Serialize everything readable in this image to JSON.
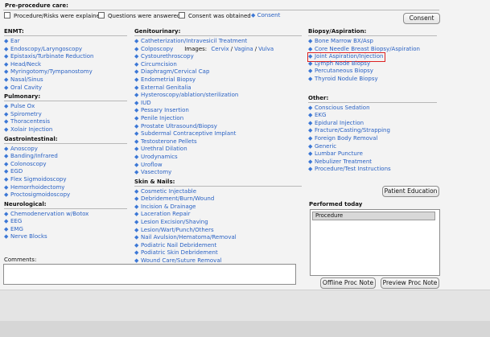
{
  "preprocedure": {
    "title": "Pre-procedure care:",
    "checks": [
      "Procedure/Risks were explained",
      "Questions were answered",
      "Consent was obtained"
    ],
    "consent_link": "Consent",
    "consent_button": "Consent"
  },
  "col1": [
    {
      "title": "ENMT:",
      "items": [
        "Ear",
        "Endoscopy/Laryngoscopy",
        "Epistaxis/Turbinate Reduction",
        "Head/Neck",
        "Myringotomy/Tympanostomy",
        "Nasal/Sinus",
        "Oral Cavity"
      ]
    },
    {
      "title": "Pulmonary:",
      "items": [
        "Pulse Ox",
        "Spirometry",
        "Thoracentesis",
        "Xolair Injection"
      ]
    },
    {
      "title": "Gastrointestinal:",
      "items": [
        "Anoscopy",
        "Banding/Infrared",
        "Colonoscopy",
        "EGD",
        "Flex Sigmoidoscopy",
        "Hemorrhoidectomy",
        "Proctosigmoidoscopy"
      ]
    },
    {
      "title": "Neurological:",
      "items": [
        "Chemodenervation w/Botox",
        "EEG",
        "EMG",
        "Nerve Blocks"
      ]
    }
  ],
  "col2": [
    {
      "title": "Genitourinary:",
      "items": [
        "Catheterization/Intravesicil Treatment",
        "Colposcopy",
        "Cystourethroscopy",
        "Circumcision",
        "Diaphragm/Cervical Cap",
        "Endometrial Biopsy",
        "External Genitalia",
        "Hysteroscopy/ablation/sterilization",
        "IUD",
        "Pessary Insertion",
        "Penile Injection",
        "Prostate Ultrasound/Biopsy",
        "Subdermal Contraceptive Implant",
        "Testosterone Pellets",
        "Urethral Dilation",
        "Urodynamics",
        "Uroflow",
        "Vasectomy"
      ]
    },
    {
      "title": "Skin & Nails:",
      "items": [
        "Cosmetic Injectable",
        "Debridement/Burn/Wound",
        "Incision & Drainage",
        "Laceration Repair",
        "Lesion Excision/Shaving",
        "Lesion/Wart/Punch/Others",
        "Nail Avulsion/Hematoma/Removal",
        "Podiatric Nail Debridement",
        "Podiatric Skin Debridement",
        "Wound Care/Suture Removal"
      ]
    }
  ],
  "colposcopy_images": {
    "label": "Images:",
    "links": [
      "Cervix",
      "Vagina",
      "Vulva"
    ],
    "sep": "/"
  },
  "col3": [
    {
      "title": "Biopsy/Aspiration:",
      "items": [
        "Bone Marrow BX/Asp",
        "Core Needle Breast Biopsy/Aspiration",
        "Joint Aspiration/Injection",
        "Lymph Node Biopsy",
        "Percutaneous Biopsy",
        "Thyroid Nodule Biopsy"
      ]
    },
    {
      "title": "Other:",
      "items": [
        "Conscious Sedation",
        "EKG",
        "Epidural Injection",
        "Fracture/Casting/Strapping",
        "Foreign Body Removal",
        "Generic",
        "Lumbar Puncture",
        "Nebulizer Treatment",
        "Procedure/Test Instructions"
      ]
    }
  ],
  "buttons": {
    "patient_education": "Patient Education",
    "offline": "Offline Proc Note",
    "preview": "Preview Proc Note"
  },
  "performed": {
    "title": "Performed today",
    "column": "Procedure"
  },
  "comments": {
    "label": "Comments:"
  },
  "colors": {
    "link": "#2a62c4",
    "diamond": "#3b77d6",
    "highlight": "#dd2222"
  }
}
